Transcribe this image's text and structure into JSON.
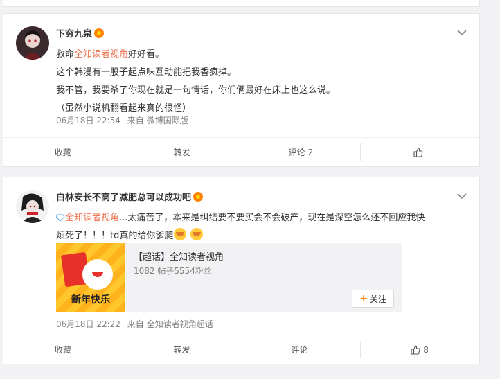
{
  "posts": [
    {
      "username": "下穷九泉",
      "text_lines": [
        [
          "救命",
          "全知读者视角",
          "好好看。"
        ],
        "这个韩漫有一股子起点味互动能把我香疯掉。",
        "我不管，我要杀了你现在就是一句情话，你们俩最好在床上也这么说。",
        "（虽然小说机翻看起来真的很怪）"
      ],
      "time": "06月18日 22:54",
      "source_prefix": "来自",
      "source": "微博国际版",
      "actions": {
        "collect": "收藏",
        "repost": "转发",
        "comment": "评论",
        "comment_count": "2",
        "like_count": ""
      }
    },
    {
      "username": "白林安长不高了减肥总可以成功吧",
      "topic_link": "全知读者视角",
      "text_line1": "...太痛苦了，本来是纠结要不要买会不会破产，现在是深空怎么还不回应我快",
      "text_line2": "烦死了！！！td真的给你爹爬",
      "super_topic": {
        "title": "【超话】全知读者视角",
        "stats": "1082 帖子5554粉丝",
        "thumb_text": "新年快乐",
        "follow_label": "关注"
      },
      "time": "06月18日 22:22",
      "source_prefix": "来自",
      "source": "全知读者视角超话",
      "actions": {
        "collect": "收藏",
        "repost": "转发",
        "comment": "评论",
        "comment_count": "",
        "like_count": "8"
      }
    }
  ],
  "colors": {
    "link": "#eb7350",
    "accent": "#ff8200",
    "page_bg": "#f2f2f5"
  }
}
